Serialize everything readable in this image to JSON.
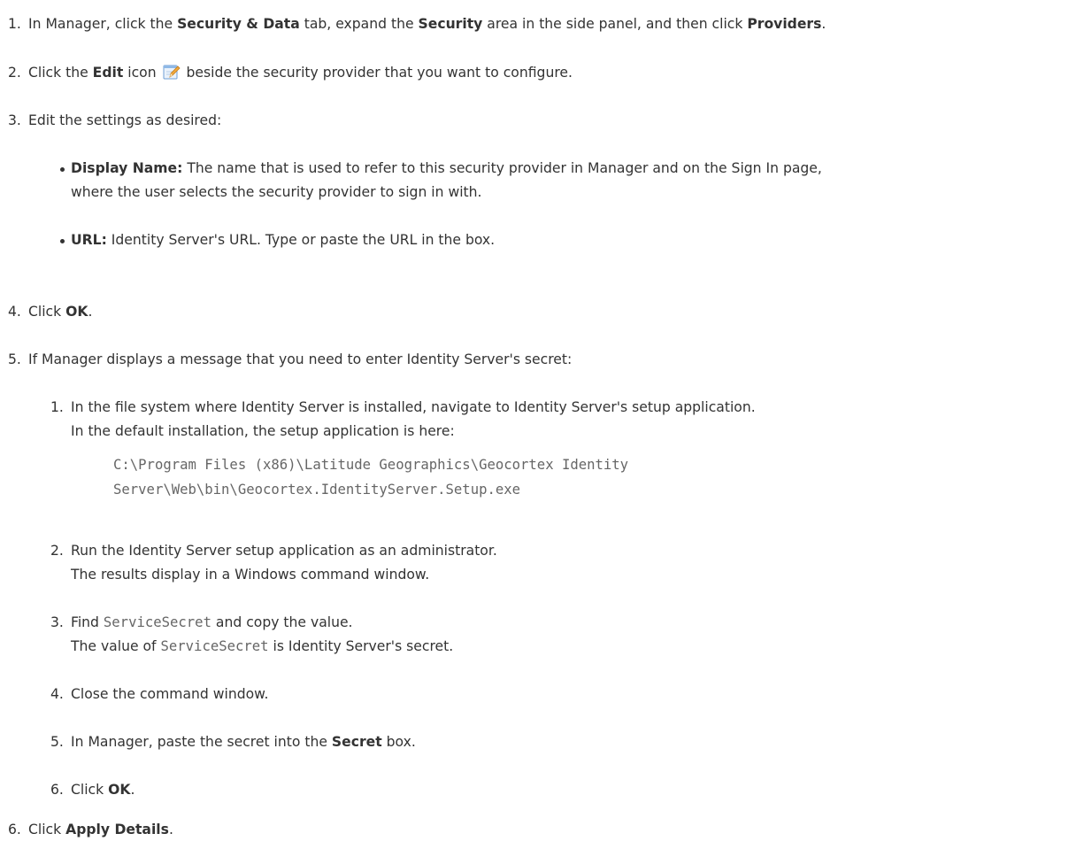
{
  "steps": [
    {
      "num": "1.",
      "parts": [
        "In Manager, click the ",
        "Security & Data",
        " tab, expand the ",
        "Security",
        " area in the side panel, and then click ",
        "Providers",
        "."
      ]
    },
    {
      "num": "2.",
      "pre": "Click the ",
      "bold": "Edit",
      "mid": " icon",
      "icon": "edit-icon",
      "post": " beside the security provider that you want to configure."
    },
    {
      "num": "3.",
      "text": "Edit the settings as desired:",
      "bullets": [
        {
          "label": "Display Name:",
          "text": " The name that is used to refer to this security provider in Manager and on the Sign In page,",
          "text2": "where the user selects the security provider to sign in with."
        },
        {
          "label": "URL:",
          "text": " Identity Server's URL. Type or paste the URL in the box."
        }
      ]
    },
    {
      "num": "4.",
      "pre": "Click ",
      "bold": "OK",
      "post": "."
    },
    {
      "num": "5.",
      "text": "If Manager displays a message that you need to enter Identity Server's secret:",
      "substeps": [
        {
          "num": "1.",
          "line1": "In the file system where Identity Server is installed, navigate to Identity Server's setup application.",
          "line2": "In the default installation, the setup application is here:",
          "code1": "C:\\Program Files (x86)\\Latitude Geographics\\Geocortex Identity",
          "code2": "Server\\Web\\bin\\Geocortex.IdentityServer.Setup.exe"
        },
        {
          "num": "2.",
          "line1": "Run the Identity Server setup application as an administrator.",
          "line2": "The results display in a Windows command window."
        },
        {
          "num": "3.",
          "pre": "Find ",
          "code": "ServiceSecret",
          "post": " and copy the value.",
          "line2_pre": "The value of ",
          "line2_code": "ServiceSecret",
          "line2_post": " is Identity Server's secret."
        },
        {
          "num": "4.",
          "line1": "Close the command window."
        },
        {
          "num": "5.",
          "pre": "In Manager, paste the secret into the ",
          "bold": "Secret",
          "post": " box."
        },
        {
          "num": "6.",
          "pre": "Click ",
          "bold": "OK",
          "post": "."
        }
      ]
    },
    {
      "num": "6.",
      "pre": "Click ",
      "bold": "Apply Details",
      "post": "."
    }
  ]
}
